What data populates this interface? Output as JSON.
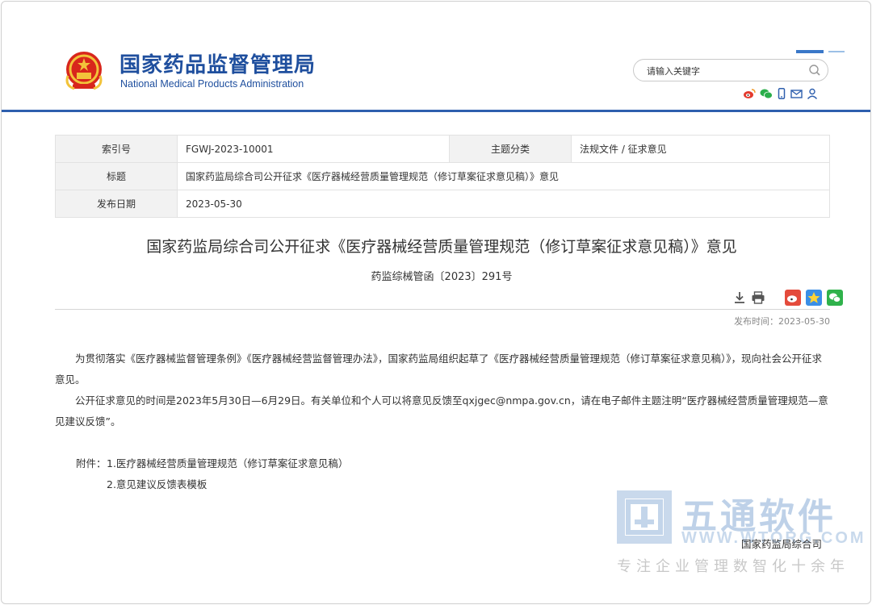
{
  "header": {
    "org_name_cn": "国家药品监督管理局",
    "org_name_en": "National Medical Products Administration",
    "search_placeholder": "请输入关键字",
    "brand_color": "#1f4f9e",
    "social_icons": [
      "weibo-icon",
      "wechat-icon",
      "mobile-icon",
      "mail-icon",
      "user-icon"
    ]
  },
  "meta": {
    "index_label": "索引号",
    "index_value": "FGWJ-2023-10001",
    "topic_label": "主题分类",
    "topic_value": "法规文件 / 征求意见",
    "title_label": "标题",
    "title_value": "国家药监局综合司公开征求《医疗器械经营质量管理规范（修订草案征求意见稿）》意见",
    "date_label": "发布日期",
    "date_value": "2023-05-30"
  },
  "article": {
    "title": "国家药监局综合司公开征求《医疗器械经营质量管理规范（修订草案征求意见稿）》意见",
    "doc_number": "药监综械管函〔2023〕291号",
    "publish_time": "发布时间：2023-05-30",
    "paragraph1": "为贯彻落实《医疗器械监督管理条例》《医疗器械经营监督管理办法》，国家药监局组织起草了《医疗器械经营质量管理规范（修订草案征求意见稿）》，现向社会公开征求意见。",
    "paragraph2": "公开征求意见的时间是2023年5月30日—6月29日。有关单位和个人可以将意见反馈至qxjgec@nmpa.gov.cn，请在电子邮件主题注明“医疗器械经营质量管理规范—意见建议反馈”。",
    "attachments_label": "附件：",
    "attachments": [
      "1.医疗器械经营质量管理规范（修订草案征求意见稿）",
      "2.意见建议反馈表模板"
    ],
    "signature": "国家药监局综合司"
  },
  "watermark": {
    "name": "五通软件",
    "url": "WWW.WTORG.COM",
    "slogan": "专注企业管理数智化十余年"
  }
}
